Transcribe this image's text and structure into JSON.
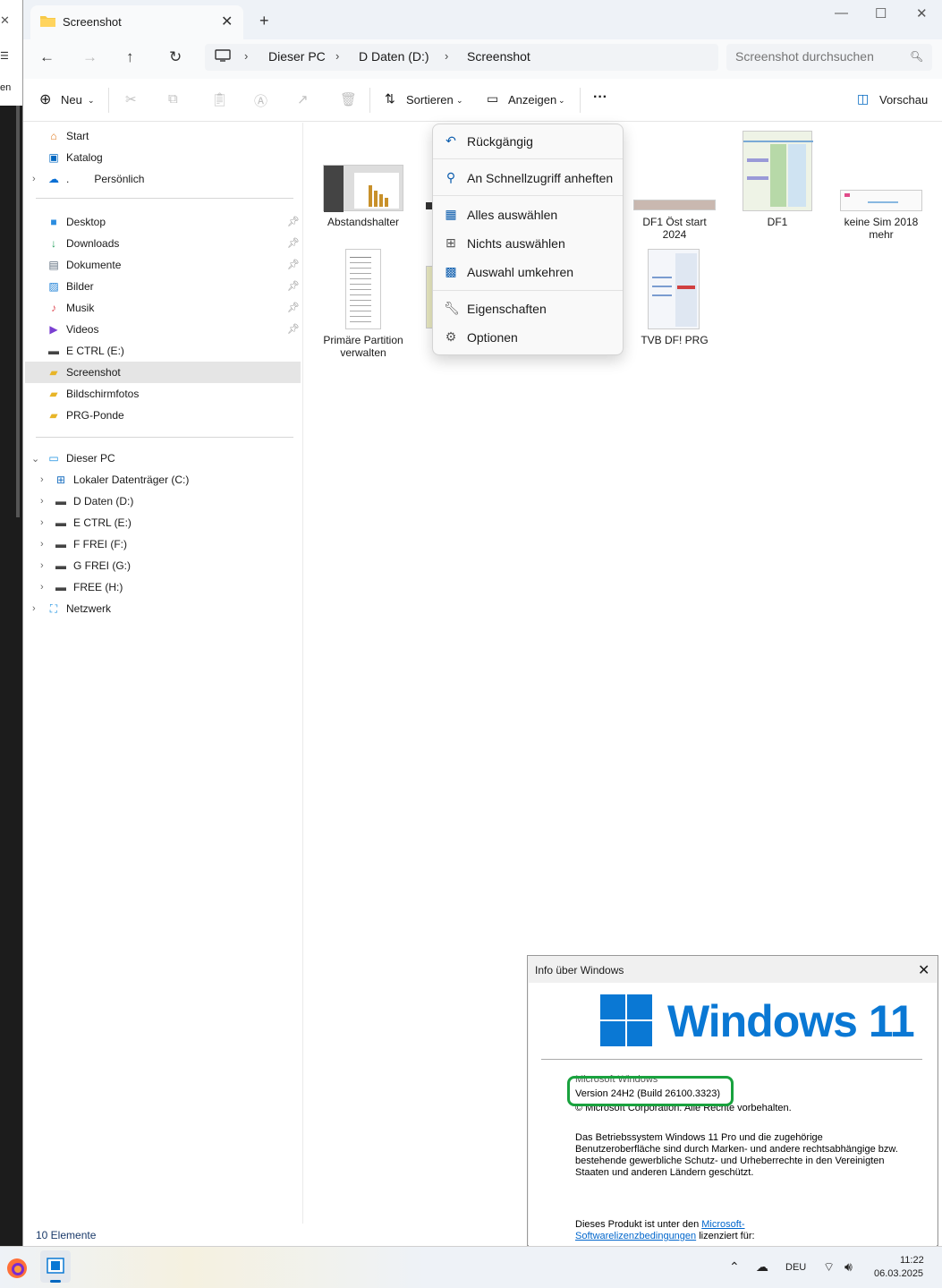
{
  "background": {
    "left_label": "en"
  },
  "window": {
    "tab_title": "Screenshot",
    "colors": {
      "accent": "#0067c0",
      "folder": "#f7c948"
    }
  },
  "address": {
    "crumbs": [
      "Dieser PC",
      "D Daten  (D:)",
      "Screenshot"
    ]
  },
  "search": {
    "placeholder": "Screenshot durchsuchen"
  },
  "toolbar": {
    "new_label": "Neu",
    "sort_label": "Sortieren",
    "view_label": "Anzeigen",
    "more_label": "···",
    "preview_label": "Vorschau"
  },
  "sidebar": {
    "top": [
      {
        "label": "Start"
      },
      {
        "label": "Katalog"
      },
      {
        "label": "Persönlich",
        "prefix": "."
      }
    ],
    "quick": [
      {
        "label": "Desktop"
      },
      {
        "label": "Downloads"
      },
      {
        "label": "Dokumente"
      },
      {
        "label": "Bilder"
      },
      {
        "label": "Musik"
      },
      {
        "label": "Videos"
      },
      {
        "label": "E CTRL (E:)"
      },
      {
        "label": "Screenshot"
      },
      {
        "label": "Bildschirmfotos"
      },
      {
        "label": "PRG-Ponde"
      }
    ],
    "pc_label": "Dieser PC",
    "drives": [
      {
        "label": "Lokaler Datenträger (C:)"
      },
      {
        "label": "D Daten  (D:)"
      },
      {
        "label": "E CTRL (E:)"
      },
      {
        "label": "F FREI (F:)"
      },
      {
        "label": "G FREI (G:)"
      },
      {
        "label": "FREE (H:)"
      }
    ],
    "network_label": "Netzwerk"
  },
  "files": [
    {
      "name": "Abstandshalter"
    },
    {
      "name": "DF1 Öst start 2024"
    },
    {
      "name": "DF1"
    },
    {
      "name": "keine Sim 2018 mehr"
    },
    {
      "name": "Primäre Partition verwalten"
    },
    {
      "name": "TVB DF! PRG"
    }
  ],
  "context_menu": {
    "undo": "Rückgängig",
    "pin": "An Schnellzugriff anheften",
    "select_all": "Alles auswählen",
    "select_none": "Nichts auswählen",
    "invert": "Auswahl umkehren",
    "properties": "Eigenschaften",
    "options": "Optionen"
  },
  "status": {
    "count": "10 Elemente"
  },
  "about": {
    "title": "Info über Windows",
    "product": "Windows 11",
    "line1": "Microsoft Windows",
    "version": "Version 24H2 (Build 26100.3323)",
    "copyright": "© Microsoft Corporation. Alle Rechte vorbehalten.",
    "body1": "Das Betriebssystem Windows 11 Pro und die zugehörige",
    "body2": "Benutzeroberfläche sind durch Marken- und andere rechtsabhängige bzw.",
    "body3": "bestehende gewerbliche Schutz- und Urheberrechte in den Vereinigten",
    "body4": "Staaten und anderen Ländern geschützt.",
    "license_prefix": "Dieses Produkt ist unter den",
    "license_link1": "Microsoft-",
    "license_link2": "Softwarelizenzbedingungen",
    "license_suffix": "lizenziert für:"
  },
  "taskbar": {
    "lang": "DEU",
    "time": "11:22",
    "date": "06.03.2025"
  }
}
